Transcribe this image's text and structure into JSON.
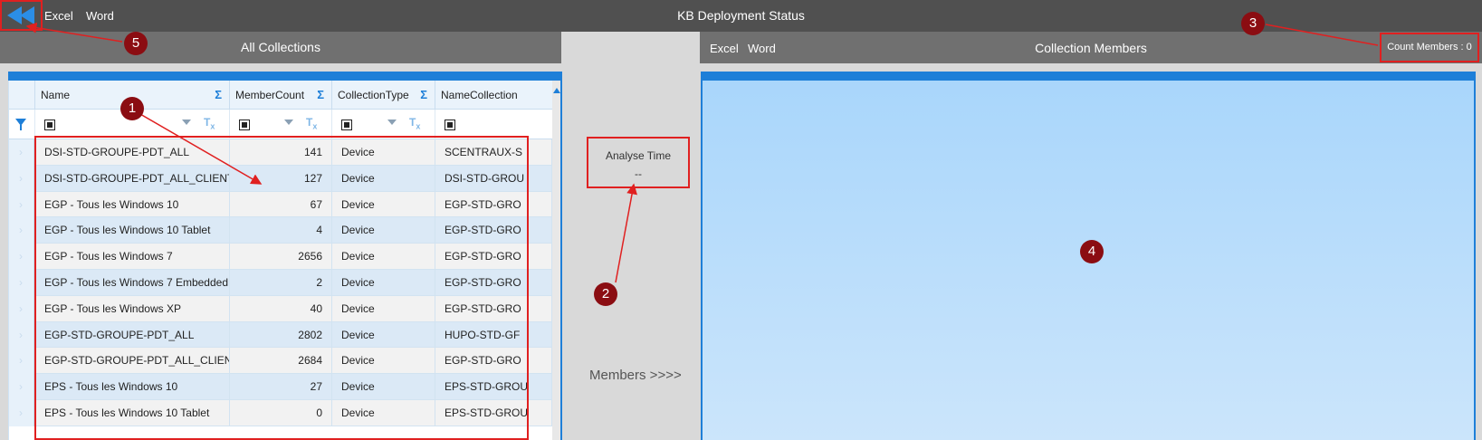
{
  "topbar": {
    "back_icon": "double-chevron-left-icon",
    "excel_label": "Excel",
    "word_label": "Word",
    "title": "KB Deployment Status"
  },
  "left_panel": {
    "title": "All Collections",
    "columns": [
      {
        "label": "Name",
        "has_sum": true
      },
      {
        "label": "MemberCount",
        "has_sum": true
      },
      {
        "label": "CollectionType",
        "has_sum": true
      },
      {
        "label": "NameCollection",
        "has_sum": false
      }
    ],
    "sum_symbol": "Σ",
    "rows": [
      {
        "name": "DSI-STD-GROUPE-PDT_ALL",
        "count": "141",
        "type": "Device",
        "namecol": "SCENTRAUX-S"
      },
      {
        "name": "DSI-STD-GROUPE-PDT_ALL_CLIENT",
        "count": "127",
        "type": "Device",
        "namecol": "DSI-STD-GROU"
      },
      {
        "name": "EGP - Tous les Windows 10",
        "count": "67",
        "type": "Device",
        "namecol": "EGP-STD-GRO"
      },
      {
        "name": "EGP - Tous les Windows 10 Tablet",
        "count": "4",
        "type": "Device",
        "namecol": "EGP-STD-GRO"
      },
      {
        "name": "EGP - Tous les Windows 7",
        "count": "2656",
        "type": "Device",
        "namecol": "EGP-STD-GRO"
      },
      {
        "name": "EGP - Tous les Windows 7 Embedded",
        "count": "2",
        "type": "Device",
        "namecol": "EGP-STD-GRO"
      },
      {
        "name": "EGP - Tous les Windows XP",
        "count": "40",
        "type": "Device",
        "namecol": "EGP-STD-GRO"
      },
      {
        "name": "EGP-STD-GROUPE-PDT_ALL",
        "count": "2802",
        "type": "Device",
        "namecol": "HUPO-STD-GF"
      },
      {
        "name": "EGP-STD-GROUPE-PDT_ALL_CLIENT",
        "count": "2684",
        "type": "Device",
        "namecol": "EGP-STD-GRO"
      },
      {
        "name": "EPS - Tous les Windows 10",
        "count": "27",
        "type": "Device",
        "namecol": "EPS-STD-GROU"
      },
      {
        "name": "EPS - Tous les Windows 10 Tablet",
        "count": "0",
        "type": "Device",
        "namecol": "EPS-STD-GROU"
      }
    ]
  },
  "middle": {
    "analyse_label": "Analyse Time",
    "analyse_value": "--",
    "members_button": "Members >>>>"
  },
  "right_panel": {
    "excel_label": "Excel",
    "word_label": "Word",
    "title": "Collection Members",
    "count_label": "Count Members : 0"
  },
  "annotations": {
    "badges": [
      "1",
      "2",
      "3",
      "4",
      "5"
    ],
    "badge_color": "#8b0d12",
    "highlight_color": "#e02020"
  },
  "colors": {
    "accent": "#1e7fd8",
    "topbar": "#505050",
    "panel_header": "#707070"
  }
}
